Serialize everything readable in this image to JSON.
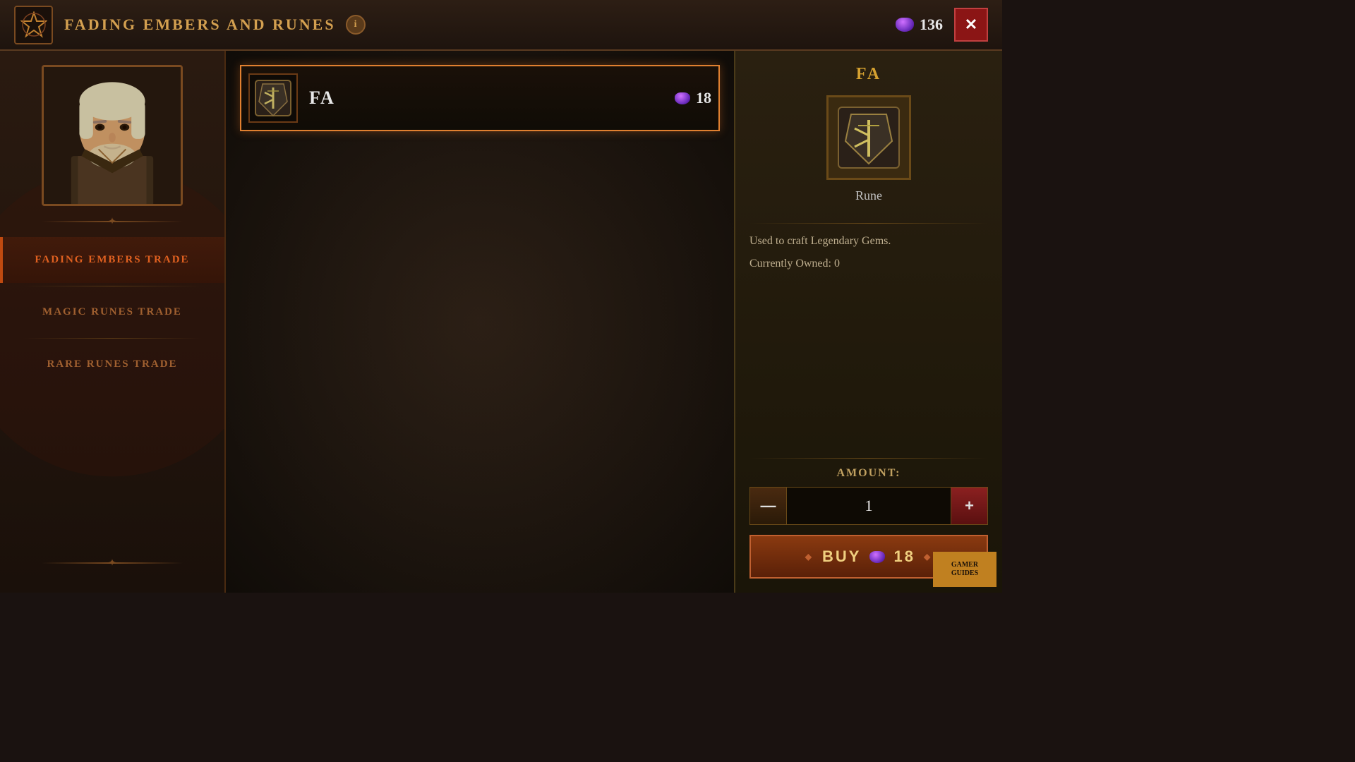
{
  "header": {
    "title": "FADING EMBERS AND RUNES",
    "info_label": "i",
    "currency": {
      "amount": "136"
    },
    "close_label": "✕"
  },
  "sidebar": {
    "items": [
      {
        "id": "fading-embers",
        "label": "FADING\nEMBERS\nTRADE",
        "active": true
      },
      {
        "id": "magic-runes",
        "label": "MAGIC RUNES TRADE",
        "active": false
      },
      {
        "id": "rare-runes",
        "label": "RARE RUNES TRADE",
        "active": false
      }
    ]
  },
  "item_list": [
    {
      "id": "fa",
      "name": "FA",
      "cost": "18",
      "selected": true
    }
  ],
  "right_panel": {
    "title": "FA",
    "item_type": "Rune",
    "description": "Used to craft Legendary Gems.",
    "owned_label": "Currently Owned: 0",
    "amount_label": "AMOUNT:",
    "amount_value": "1",
    "buy_label": "BUY",
    "buy_cost": "18",
    "minus_label": "—",
    "plus_label": "+"
  },
  "watermark": {
    "line1": "GAMER",
    "line2": "GUIDES"
  }
}
